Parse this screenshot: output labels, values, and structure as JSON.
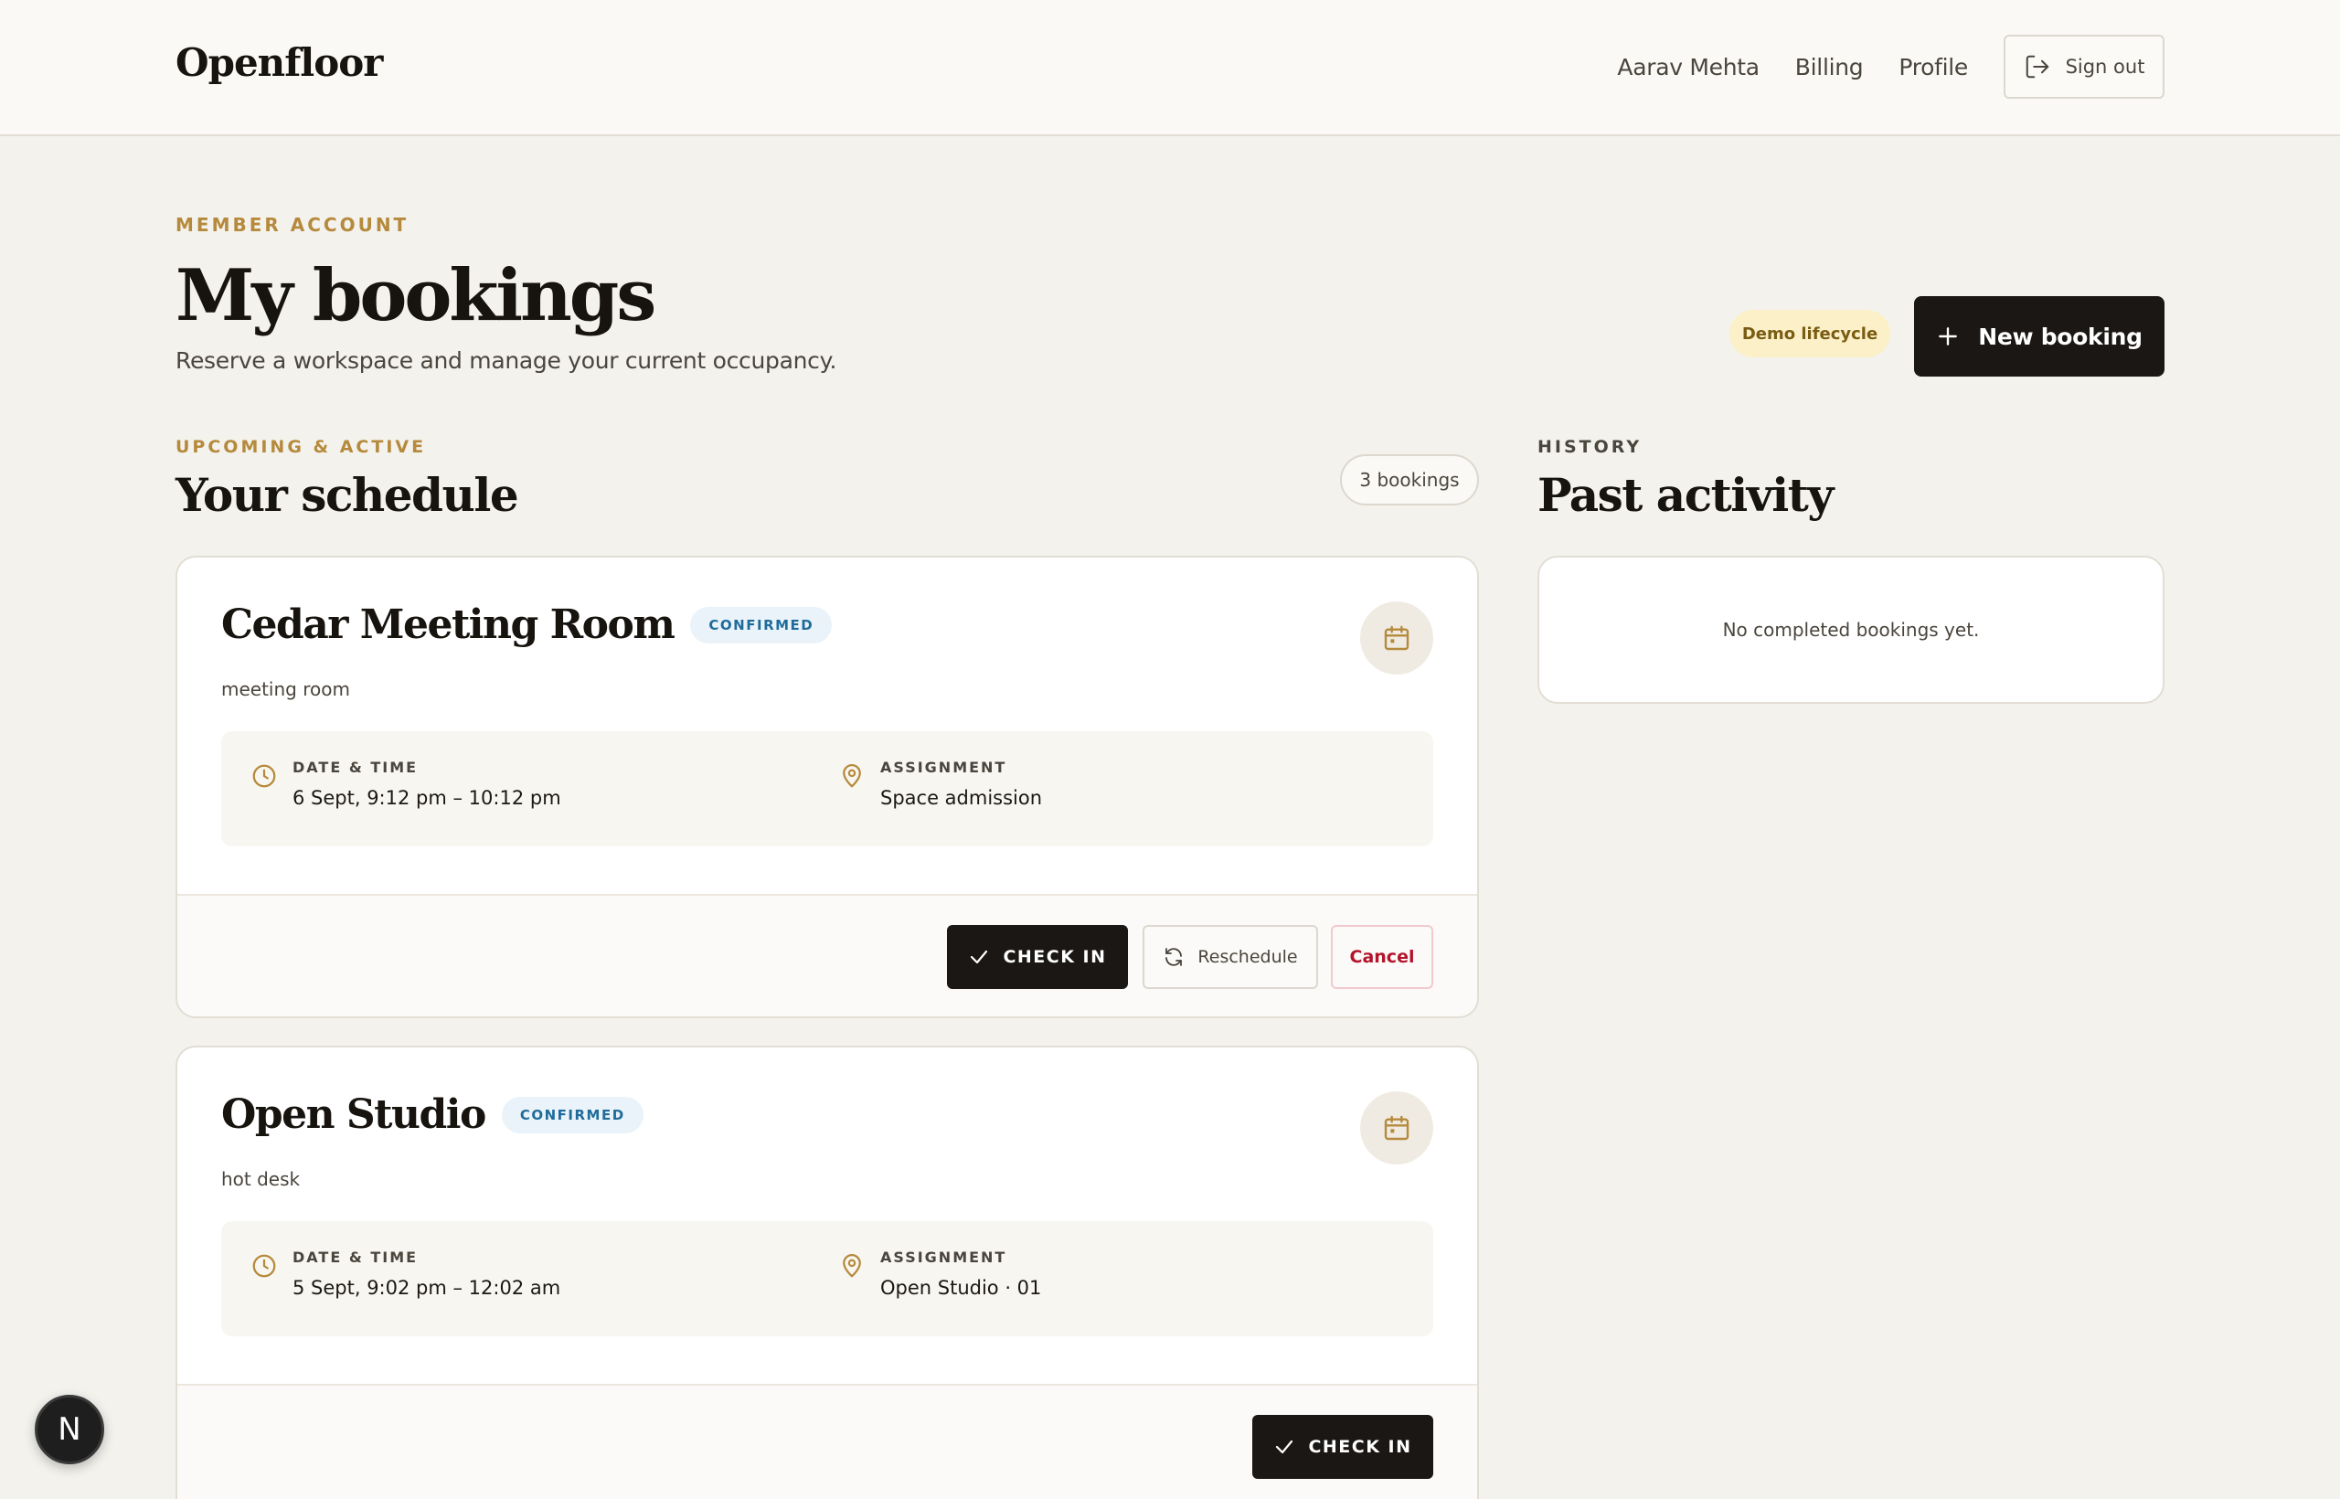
{
  "app": {
    "brand": "Openfloor"
  },
  "nav": {
    "user_name": "Aarav Mehta",
    "billing": "Billing",
    "profile": "Profile",
    "sign_out": "Sign out"
  },
  "page": {
    "eyebrow": "MEMBER ACCOUNT",
    "title": "My bookings",
    "subtitle": "Reserve a workspace and manage your current occupancy.",
    "demo_badge": "Demo lifecycle",
    "new_booking": "New booking"
  },
  "schedule": {
    "eyebrow": "UPCOMING & ACTIVE",
    "title": "Your schedule",
    "count": "3 bookings",
    "bookings": [
      {
        "name": "Cedar Meeting Room",
        "status": "CONFIRMED",
        "type": "meeting room",
        "datetime_label": "DATE & TIME",
        "datetime": "6 Sept, 9:12 pm – 10:12 pm",
        "assignment_label": "ASSIGNMENT",
        "assignment": "Space admission",
        "actions": {
          "check_in": "CHECK IN",
          "reschedule": "Reschedule",
          "cancel": "Cancel"
        }
      },
      {
        "name": "Open Studio",
        "status": "CONFIRMED",
        "type": "hot desk",
        "datetime_label": "DATE & TIME",
        "datetime": "5 Sept, 9:02 pm – 12:02 am",
        "assignment_label": "ASSIGNMENT",
        "assignment": "Open Studio · 01",
        "actions": {
          "check_in": "CHECK IN"
        }
      }
    ]
  },
  "history": {
    "eyebrow": "HISTORY",
    "title": "Past activity",
    "empty": "No completed bookings yet."
  },
  "dev_badge": {
    "letter": "N"
  },
  "colors": {
    "accent": "#b58a3c",
    "dark": "#1a1714",
    "status_blue": "#1f6c9a",
    "danger": "#b3142b"
  }
}
